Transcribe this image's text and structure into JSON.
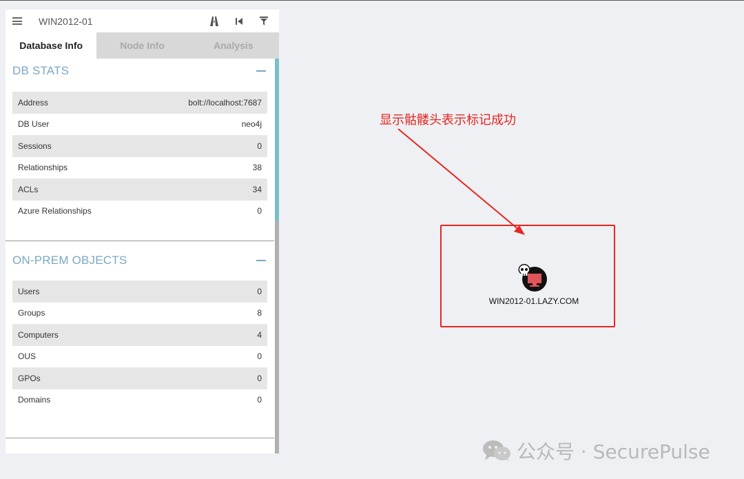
{
  "panel": {
    "header_title": "WIN2012-01",
    "tabs": [
      {
        "label": "Database Info"
      },
      {
        "label": "Node Info"
      },
      {
        "label": "Analysis"
      }
    ],
    "db_stats": {
      "title": "DB STATS",
      "rows": [
        {
          "label": "Address",
          "value": "bolt://localhost:7687"
        },
        {
          "label": "DB User",
          "value": "neo4j"
        },
        {
          "label": "Sessions",
          "value": "0"
        },
        {
          "label": "Relationships",
          "value": "38"
        },
        {
          "label": "ACLs",
          "value": "34"
        },
        {
          "label": "Azure Relationships",
          "value": "0"
        }
      ]
    },
    "onprem": {
      "title": "ON-PREM OBJECTS",
      "rows": [
        {
          "label": "Users",
          "value": "0"
        },
        {
          "label": "Groups",
          "value": "8"
        },
        {
          "label": "Computers",
          "value": "4"
        },
        {
          "label": "OUS",
          "value": "0"
        },
        {
          "label": "GPOs",
          "value": "0"
        },
        {
          "label": "Domains",
          "value": "0"
        }
      ]
    }
  },
  "canvas": {
    "annotation_text": "显示骷髅头表示标记成功",
    "node_label": "WIN2012-01.LAZY.COM",
    "node_icons": [
      "skull-icon",
      "computer-icon"
    ]
  },
  "watermark": {
    "text": "公众号 · SecurePulse"
  },
  "colors": {
    "accent": "#7aa8c2",
    "annotation_red": "#e8251f",
    "node_red": "#e0555a",
    "scroll_thumb": "#7cbfc6"
  }
}
